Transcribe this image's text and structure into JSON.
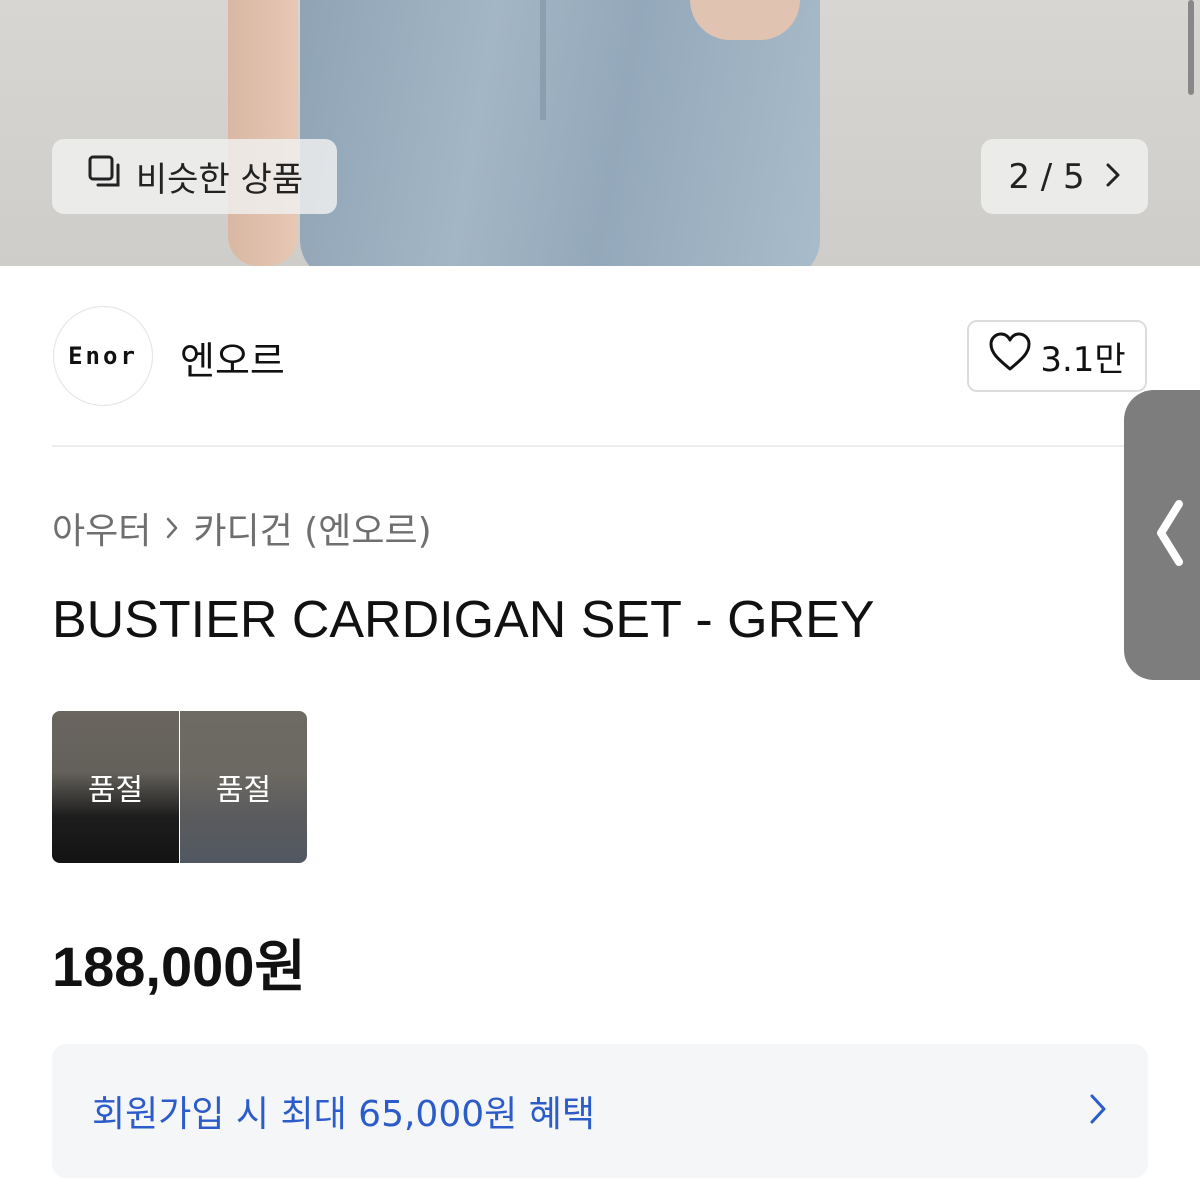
{
  "hero": {
    "similar_label": "비슷한 상품",
    "counter": "2 / 5"
  },
  "brand": {
    "logo_text": "Enor",
    "name": "엔오르",
    "likes": "3.1만"
  },
  "breadcrumb": {
    "category": "아우터",
    "subcategory": "카디건 (엔오르)"
  },
  "product": {
    "title": "BUSTIER CARDIGAN SET - GREY",
    "price": "188,000원",
    "variants": [
      {
        "label": "품절"
      },
      {
        "label": "품절"
      }
    ]
  },
  "benefit": {
    "text": "회원가입 시 최대 65,000원 혜택"
  },
  "colors": {
    "accent": "#2b5cc9",
    "muted_text": "#6f6f6f",
    "benefit_bg": "#f5f6f8"
  }
}
